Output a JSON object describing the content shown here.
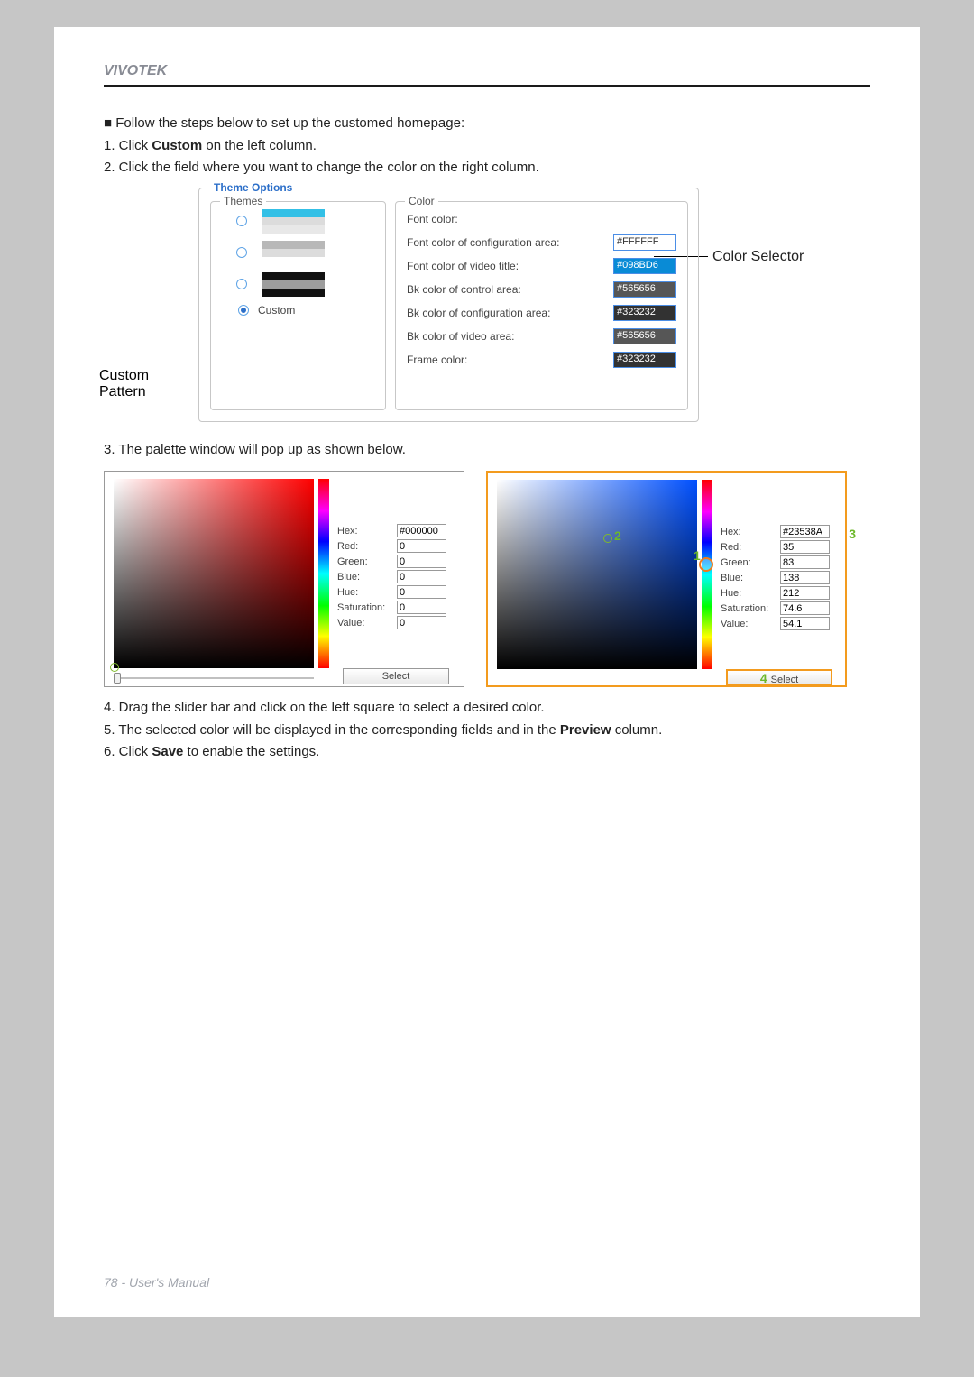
{
  "brand": "VIVOTEK",
  "intro": {
    "bullet": "■ Follow the steps below to set up the customed homepage:",
    "step1_a": "1. Click ",
    "step1_b": "Custom",
    "step1_c": " on the left column.",
    "step2": "2. Click the field where you want to change the color on the right column."
  },
  "annot": {
    "custom_pattern_a": "Custom",
    "custom_pattern_b": "Pattern",
    "color_selector": "Color Selector"
  },
  "theme_options": {
    "legend": "Theme Options",
    "themes": {
      "legend": "Themes",
      "custom_label": "Custom"
    },
    "color": {
      "legend": "Color",
      "rows": {
        "font_color": "Font color:",
        "font_cfg": "Font color of configuration area:",
        "font_video": "Font color of video title:",
        "bk_control": "Bk color of control area:",
        "bk_cfg": "Bk color of configuration area:",
        "bk_video": "Bk color of video area:",
        "frame": "Frame color:"
      },
      "values": {
        "font_cfg": "#FFFFFF",
        "font_video": "#098BD6",
        "bk_control": "#565656",
        "bk_cfg": "#323232",
        "bk_video": "#565656",
        "frame": "#323232"
      }
    }
  },
  "step3": "3. The palette window will pop up as shown below.",
  "palette_labels": {
    "hex": "Hex:",
    "red": "Red:",
    "green": "Green:",
    "blue": "Blue:",
    "hue": "Hue:",
    "saturation": "Saturation:",
    "value": "Value:",
    "select": "Select"
  },
  "palette1": {
    "hex": "#000000",
    "red": "0",
    "green": "0",
    "blue": "0",
    "hue": "0",
    "saturation": "0",
    "value": "0"
  },
  "palette2": {
    "hex": "#23538A",
    "red": "35",
    "green": "83",
    "blue": "138",
    "hue": "212",
    "saturation": "74.6",
    "value": "54.1"
  },
  "markers": {
    "m1": "1",
    "m2": "2",
    "m3": "3",
    "m4": "4"
  },
  "step4": "4. Drag the slider bar and click on the left square to select a desired color.",
  "step5_a": "5. The selected color will be displayed in the corresponding fields and in the ",
  "step5_b": "Preview",
  "step5_c": " column.",
  "step6_a": "6. Click ",
  "step6_b": "Save",
  "step6_c": " to enable the settings.",
  "footer": "78 - User's Manual"
}
